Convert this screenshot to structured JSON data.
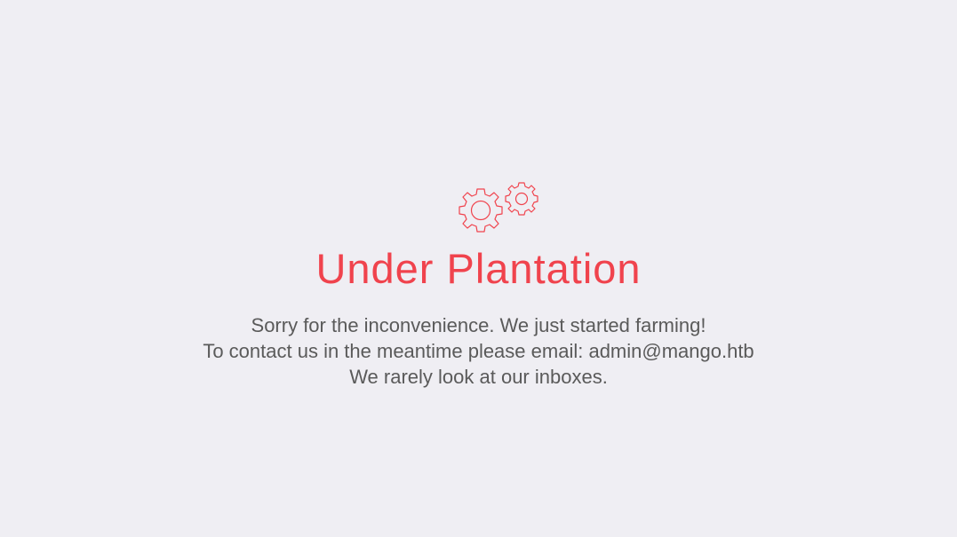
{
  "page": {
    "background": "#efeef3",
    "accent_color": "#f0434d",
    "text_color": "#5a5a5a"
  },
  "icon": {
    "name": "gears-icon"
  },
  "heading": {
    "title": "Under Plantation"
  },
  "message": {
    "line1": "Sorry for the inconvenience. We just started farming!",
    "line2_prefix": "To contact us in the meantime please email: ",
    "email": "admin@mango.htb",
    "line3": "We rarely look at our inboxes."
  }
}
